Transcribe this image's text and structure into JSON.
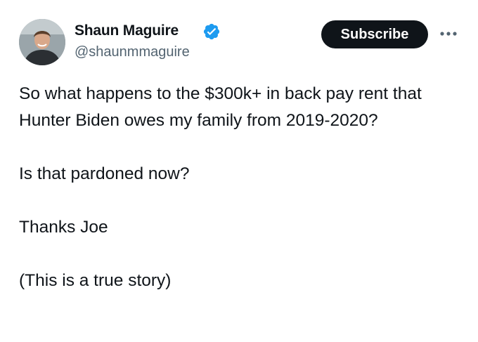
{
  "author": {
    "name": "Shaun Maguire",
    "handle": "@shaunmmaguire",
    "verified": true,
    "verified_icon": "verified-badge-icon",
    "verified_color": "#1d9bf0"
  },
  "actions": {
    "subscribe_label": "Subscribe",
    "more_icon": "more-horizontal-icon"
  },
  "tweet": {
    "paragraphs": [
      "So what happens to the $300k+ in back pay rent that Hunter Biden owes my family from 2019-2020?",
      "Is that pardoned now?",
      "Thanks Joe",
      "(This is a true story)"
    ]
  },
  "colors": {
    "text": "#0f1419",
    "secondary_text": "#536471",
    "button_bg": "#0f1419",
    "button_text": "#ffffff"
  }
}
